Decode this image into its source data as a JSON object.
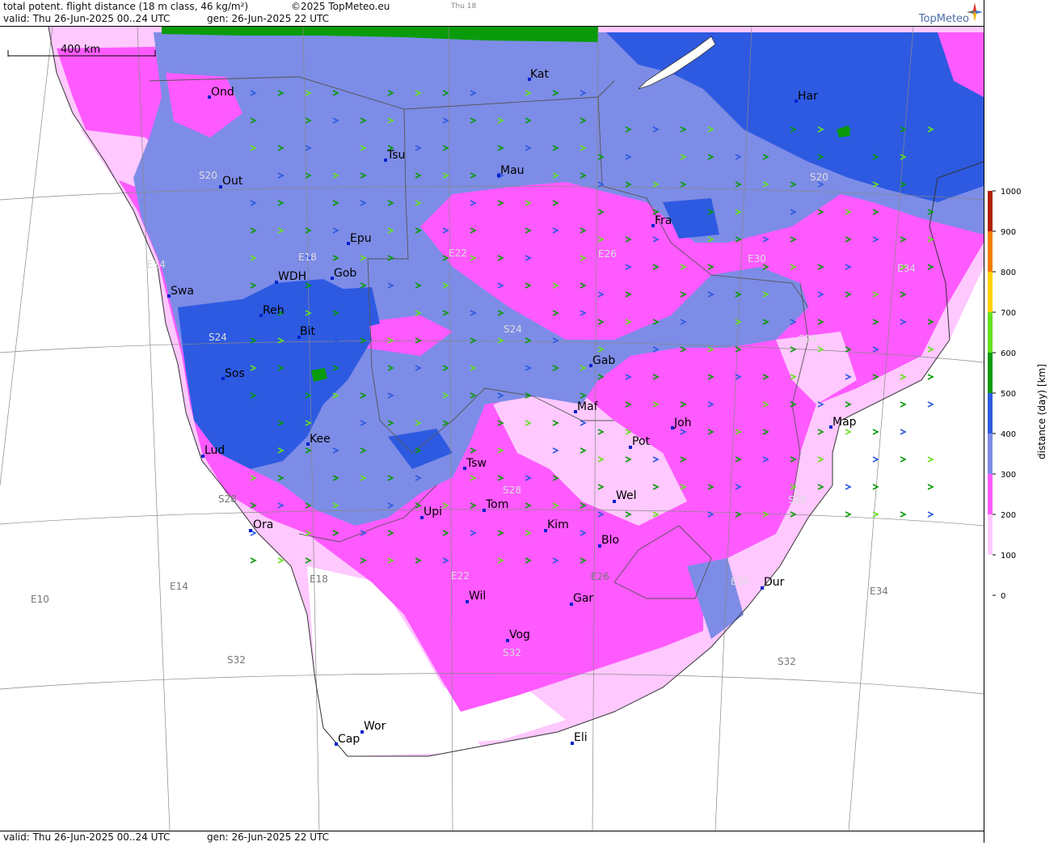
{
  "header": {
    "title": "total potent. flight distance (18 m class, 46 kg/m²)",
    "copyright": "©2025 TopMeteo.eu",
    "day_tab": "Thu 18",
    "valid": "valid:  Thu  26-Jun-2025  00..24 UTC",
    "generated": "gen: 26-Jun-2025 22 UTC"
  },
  "brand": {
    "name": "TopMeteo",
    "icon": "compass-star-icon"
  },
  "scale_bar": {
    "label": "400 km"
  },
  "footer": {
    "valid": "valid:  Thu  26-Jun-2025  00..24 UTC",
    "generated": "gen: 26-Jun-2025 22 UTC"
  },
  "legend": {
    "title": "distance (day) [km]",
    "levels": [
      "1000",
      "900",
      "800",
      "700",
      "600",
      "500",
      "400",
      "300",
      "200",
      "100",
      "0"
    ],
    "colors": {
      "c1000": "#b22000",
      "c900": "#f57d00",
      "c800": "#ffd200",
      "c700": "#ffff00",
      "c600": "#66e11e",
      "c500": "#0a9b0a",
      "c400": "#2d5ae1",
      "c300": "#7d8ce6",
      "c200": "#ff5aff",
      "c100": "#ffc8ff",
      "c0": "#ffffff"
    }
  },
  "cities": [
    {
      "name": "Kat"
    },
    {
      "name": "Ond"
    },
    {
      "name": "Har"
    },
    {
      "name": "Tsu"
    },
    {
      "name": "Mau"
    },
    {
      "name": "Out"
    },
    {
      "name": "Fra"
    },
    {
      "name": "Epu"
    },
    {
      "name": "Gob"
    },
    {
      "name": "WDH"
    },
    {
      "name": "Swa"
    },
    {
      "name": "Reh"
    },
    {
      "name": "Bit"
    },
    {
      "name": "Gab"
    },
    {
      "name": "Sos"
    },
    {
      "name": "Maf"
    },
    {
      "name": "Joh"
    },
    {
      "name": "Map"
    },
    {
      "name": "Kee"
    },
    {
      "name": "Pot"
    },
    {
      "name": "Lud"
    },
    {
      "name": "Tsw"
    },
    {
      "name": "Wel"
    },
    {
      "name": "Tom"
    },
    {
      "name": "Upi"
    },
    {
      "name": "Ora"
    },
    {
      "name": "Kim"
    },
    {
      "name": "Blo"
    },
    {
      "name": "Dur"
    },
    {
      "name": "Gar"
    },
    {
      "name": "Wil"
    },
    {
      "name": "Vog"
    },
    {
      "name": "Wor"
    },
    {
      "name": "Cap"
    },
    {
      "name": "Eli"
    }
  ],
  "grid_labels": [
    "S20",
    "S20",
    "E14",
    "E18",
    "E22",
    "E26",
    "E30",
    "E34",
    "S24",
    "S24",
    "S24",
    "S28",
    "S28",
    "S28",
    "E10",
    "E14",
    "E18",
    "E22",
    "E26",
    "E30",
    "E34",
    "S32",
    "S32",
    "S32"
  ]
}
